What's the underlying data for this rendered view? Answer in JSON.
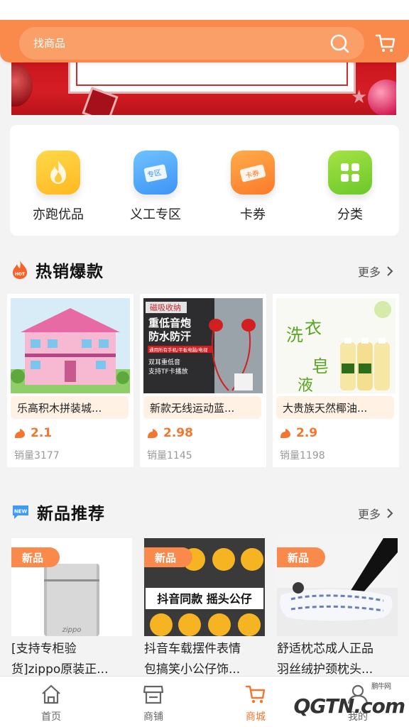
{
  "search": {
    "placeholder": "找商品"
  },
  "categories": [
    {
      "label": "亦跑优品",
      "icon": "flame-icon"
    },
    {
      "label": "义工专区",
      "icon": "ticket-zone-icon",
      "badge": "专区"
    },
    {
      "label": "卡券",
      "icon": "coupon-icon",
      "badge": "卡券"
    },
    {
      "label": "分类",
      "icon": "grid-icon"
    }
  ],
  "hot": {
    "title": "热销爆款",
    "more": "更多",
    "badge": "HOT",
    "items": [
      {
        "name": "乐高积木拼装城...",
        "price": "2.1",
        "sales": "销量3177"
      },
      {
        "name": "新款无线运动蓝...",
        "price": "2.98",
        "sales": "销量1145",
        "img_text": [
          "磁吸收纳",
          "重低音炮",
          "防水防汗",
          "通用所有手机/平板电脑/电视",
          "双耳重低音",
          "支持TF卡播放"
        ]
      },
      {
        "name": "大贵族天然椰油...",
        "price": "2.9",
        "sales": "销量1198",
        "img_text": [
          "洗",
          "衣",
          "皂",
          "液"
        ]
      }
    ]
  },
  "new": {
    "title": "新品推荐",
    "more": "更多",
    "badge": "NEW",
    "tag": "新品",
    "items": [
      {
        "line1": "[支持专柜验",
        "line2": "货]zippo原装正...",
        "img_text": "zippo"
      },
      {
        "line1": "抖音车载摆件表情",
        "line2": "包搞笑小公仔饰...",
        "img_text": "抖音同款  摇头公仔"
      },
      {
        "line1": "舒适枕芯成人正品",
        "line2": "羽丝绒护颈枕头..."
      }
    ]
  },
  "tabs": [
    {
      "label": "首页",
      "icon": "home-icon"
    },
    {
      "label": "商铺",
      "icon": "store-icon"
    },
    {
      "label": "商城",
      "icon": "cart-icon",
      "active": true
    },
    {
      "label": "我的",
      "icon": "user-icon"
    }
  ],
  "watermark": {
    "text": "QGTN.com",
    "small": "鹏牛网"
  },
  "colors": {
    "accent": "#fa8a4c",
    "price": "#f27630"
  }
}
